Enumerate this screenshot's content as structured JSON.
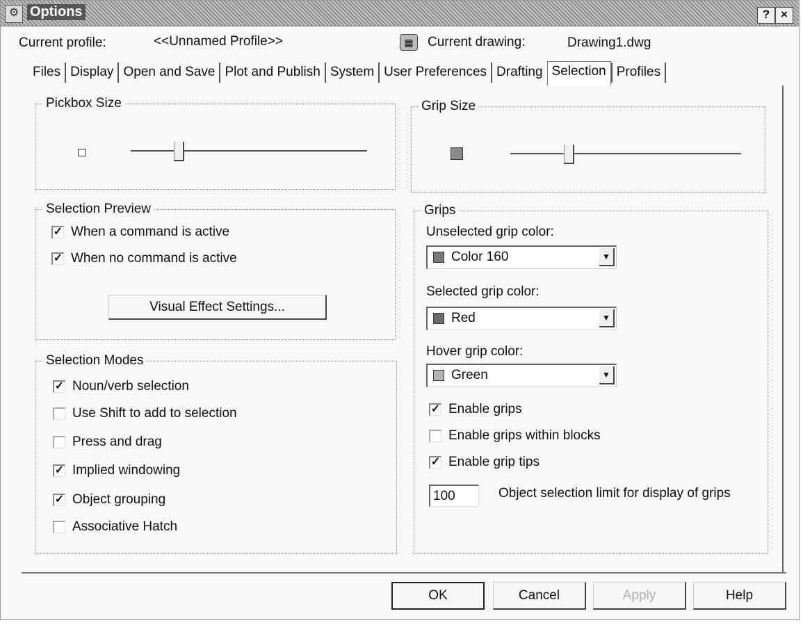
{
  "window": {
    "title": "Options",
    "help_button": "?",
    "close_button": "×"
  },
  "profile": {
    "label": "Current profile:",
    "value": "<<Unnamed Profile>>"
  },
  "drawing": {
    "label": "Current drawing:",
    "value": "Drawing1.dwg"
  },
  "tabs": [
    {
      "label": "Files"
    },
    {
      "label": "Display"
    },
    {
      "label": "Open and Save"
    },
    {
      "label": "Plot and Publish"
    },
    {
      "label": "System"
    },
    {
      "label": "User Preferences"
    },
    {
      "label": "Drafting"
    },
    {
      "label": "Selection"
    },
    {
      "label": "Profiles"
    }
  ],
  "active_tab": "Selection",
  "pickbox": {
    "title": "Pickbox Size",
    "level": 0.2
  },
  "grip_size": {
    "title": "Grip Size",
    "level": 0.25
  },
  "selection_preview": {
    "title": "Selection Preview",
    "items": [
      {
        "label": "When a command is active",
        "checked": true
      },
      {
        "label": "When no command is active",
        "checked": true
      }
    ],
    "visual_button": "Visual Effect Settings..."
  },
  "selection_modes": {
    "title": "Selection Modes",
    "items": [
      {
        "label": "Noun/verb selection",
        "checked": true
      },
      {
        "label": "Use Shift to add to selection",
        "checked": false
      },
      {
        "label": "Press and drag",
        "checked": false
      },
      {
        "label": "Implied windowing",
        "checked": true
      },
      {
        "label": "Object grouping",
        "checked": true
      },
      {
        "label": "Associative Hatch",
        "checked": false
      }
    ]
  },
  "grips": {
    "title": "Grips",
    "unselected_label": "Unselected grip color:",
    "unselected_value": "Color 160",
    "selected_label": "Selected grip color:",
    "selected_value": "Red",
    "hover_label": "Hover grip color:",
    "hover_value": "Green",
    "checks": [
      {
        "label": "Enable grips",
        "checked": true
      },
      {
        "label": "Enable grips within blocks",
        "checked": false
      },
      {
        "label": "Enable grip tips",
        "checked": true
      }
    ],
    "limit_value": "100",
    "limit_label": "Object selection limit for display of grips"
  },
  "buttons": {
    "ok": "OK",
    "cancel": "Cancel",
    "apply": "Apply",
    "help": "Help"
  },
  "colors": {
    "grip_swatch": "#8a8a8a",
    "unselected_swatch": "#7a7a7a",
    "selected_swatch": "#6a6a6a",
    "hover_swatch": "#b5b5b5",
    "disabled_text": "#b0b0b0"
  }
}
